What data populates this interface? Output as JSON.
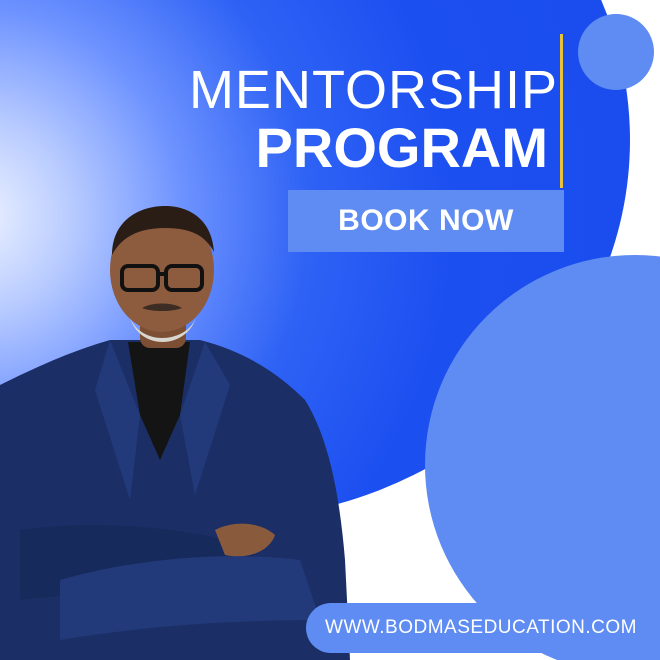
{
  "headline": {
    "line1": "MENTORSHIP",
    "line2": "PROGRAM"
  },
  "cta": {
    "label": "BOOK NOW"
  },
  "website": {
    "label": "WWW.BODMASEDUCATION.COM"
  },
  "colors": {
    "primary_blue": "#1c4ff0",
    "light_blue": "#5f8cf2",
    "accent_gold": "#e8c23a",
    "suit_navy": "#1b2f66",
    "white": "#ffffff"
  },
  "icons": {
    "portrait": "man-in-suit-arms-crossed"
  }
}
